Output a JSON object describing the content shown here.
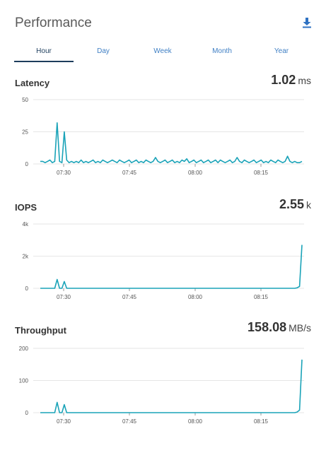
{
  "header": {
    "title": "Performance",
    "download_icon": "download-icon"
  },
  "tabs": [
    {
      "label": "Hour",
      "active": true
    },
    {
      "label": "Day",
      "active": false
    },
    {
      "label": "Week",
      "active": false
    },
    {
      "label": "Month",
      "active": false
    },
    {
      "label": "Year",
      "active": false
    }
  ],
  "colors": {
    "accent": "#1aa3b8",
    "tab_active": "#1d3d5c",
    "tab_link": "#3f7fc4",
    "grid": "#e6e6e6"
  },
  "panels": [
    {
      "label": "Latency",
      "value": "1.02",
      "unit": "ms"
    },
    {
      "label": "IOPS",
      "value": "2.55",
      "unit": "k"
    },
    {
      "label": "Throughput",
      "value": "158.08",
      "unit": "MB/s"
    }
  ],
  "chart_data": [
    {
      "type": "line",
      "title": "Latency",
      "x_tick_labels": [
        "07:30",
        "07:45",
        "08:00",
        "08:15"
      ],
      "y_tick_labels": [
        "0",
        "25",
        "50"
      ],
      "ylim": [
        0,
        50
      ],
      "grid": true,
      "series": [
        {
          "values": [
            2,
            2,
            1,
            2,
            3,
            1,
            2,
            32,
            2,
            1,
            25,
            3,
            1,
            2,
            1,
            2,
            1,
            3,
            1,
            2,
            1,
            2,
            3,
            1,
            2,
            1,
            3,
            2,
            1,
            2,
            3,
            2,
            1,
            3,
            2,
            1,
            2,
            3,
            1,
            2,
            3,
            1,
            2,
            1,
            3,
            2,
            1,
            2,
            5,
            2,
            1,
            2,
            3,
            1,
            2,
            3,
            1,
            2,
            1,
            3,
            2,
            4,
            1,
            2,
            3,
            1,
            2,
            3,
            1,
            2,
            3,
            1,
            2,
            3,
            1,
            3,
            2,
            1,
            2,
            3,
            1,
            2,
            5,
            2,
            1,
            3,
            2,
            1,
            2,
            3,
            1,
            2,
            3,
            1,
            2,
            1,
            3,
            2,
            1,
            3,
            2,
            1,
            2,
            6,
            2,
            1,
            2,
            1,
            1,
            2
          ]
        }
      ]
    },
    {
      "type": "line",
      "title": "IOPS",
      "x_tick_labels": [
        "07:30",
        "07:45",
        "08:00",
        "08:15"
      ],
      "y_tick_labels": [
        "0",
        "2k",
        "4k"
      ],
      "ylim": [
        0,
        4000
      ],
      "grid": true,
      "series": [
        {
          "values": [
            0,
            0,
            0,
            0,
            0,
            0,
            0,
            550,
            0,
            0,
            420,
            0,
            0,
            0,
            0,
            0,
            0,
            0,
            0,
            0,
            0,
            0,
            0,
            0,
            0,
            0,
            0,
            0,
            0,
            0,
            0,
            0,
            0,
            0,
            0,
            0,
            0,
            0,
            0,
            0,
            0,
            0,
            0,
            0,
            0,
            0,
            0,
            0,
            0,
            0,
            0,
            0,
            0,
            0,
            0,
            0,
            0,
            0,
            0,
            0,
            0,
            0,
            0,
            0,
            0,
            0,
            0,
            0,
            0,
            0,
            0,
            0,
            0,
            0,
            0,
            0,
            0,
            0,
            0,
            0,
            0,
            0,
            0,
            0,
            0,
            0,
            0,
            0,
            0,
            0,
            0,
            0,
            0,
            0,
            0,
            0,
            0,
            0,
            0,
            0,
            0,
            0,
            0,
            0,
            0,
            0,
            0,
            30,
            120,
            2700
          ]
        }
      ]
    },
    {
      "type": "line",
      "title": "Throughput",
      "x_tick_labels": [
        "07:30",
        "07:45",
        "08:00",
        "08:15"
      ],
      "y_tick_labels": [
        "0",
        "100",
        "200"
      ],
      "ylim": [
        0,
        200
      ],
      "grid": true,
      "series": [
        {
          "values": [
            0,
            0,
            0,
            0,
            0,
            0,
            0,
            32,
            0,
            0,
            25,
            0,
            0,
            0,
            0,
            0,
            0,
            0,
            0,
            0,
            0,
            0,
            0,
            0,
            0,
            0,
            0,
            0,
            0,
            0,
            0,
            0,
            0,
            0,
            0,
            0,
            0,
            0,
            0,
            0,
            0,
            0,
            0,
            0,
            0,
            0,
            0,
            0,
            0,
            0,
            0,
            0,
            0,
            0,
            0,
            0,
            0,
            0,
            0,
            0,
            0,
            0,
            0,
            0,
            0,
            0,
            0,
            0,
            0,
            0,
            0,
            0,
            0,
            0,
            0,
            0,
            0,
            0,
            0,
            0,
            0,
            0,
            0,
            0,
            0,
            0,
            0,
            0,
            0,
            0,
            0,
            0,
            0,
            0,
            0,
            0,
            0,
            0,
            0,
            0,
            0,
            0,
            0,
            0,
            0,
            0,
            0,
            2,
            8,
            165
          ]
        }
      ]
    }
  ]
}
